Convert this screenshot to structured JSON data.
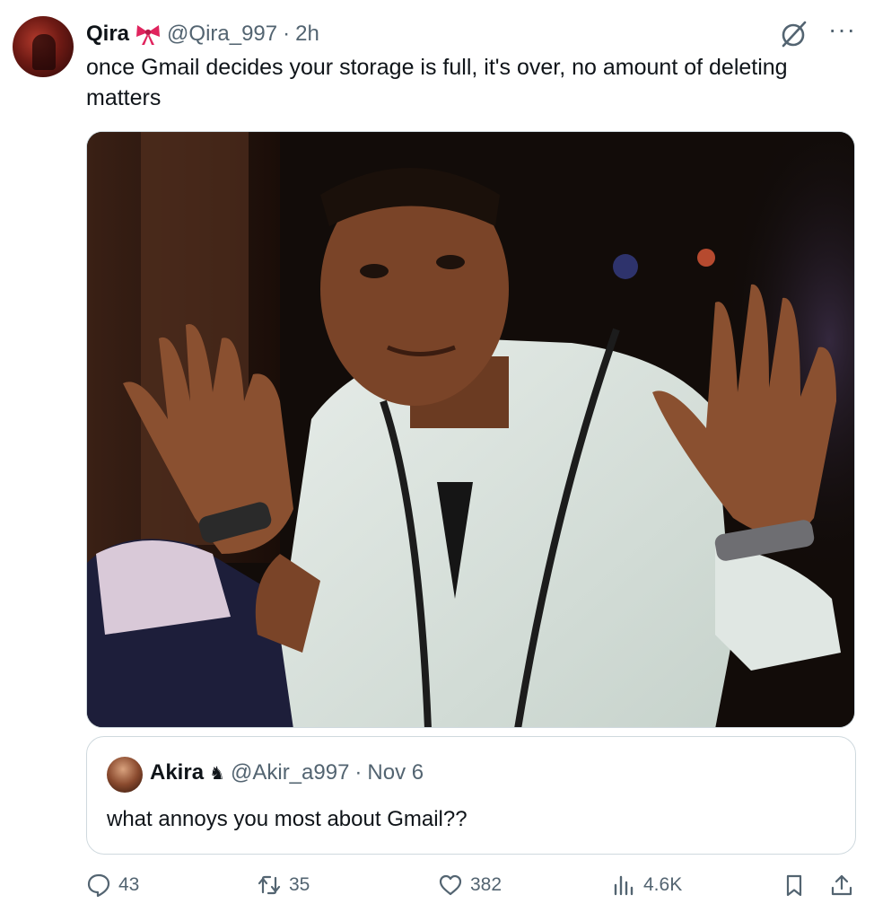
{
  "tweet": {
    "author_name": "Qira",
    "author_handle": "@Qira_997",
    "separator": "·",
    "time": "2h",
    "text": "once Gmail decides your storage is full, it's over, no amount of deleting matters"
  },
  "quoted_tweet": {
    "author_name": "Akira",
    "author_handle": "@Akir_a997",
    "separator": "·",
    "date": "Nov 6",
    "text": "what annoys you most about Gmail??"
  },
  "actions": {
    "replies": "43",
    "retweets": "35",
    "likes": "382",
    "views": "4.6K"
  },
  "icons": {
    "author_badge": "red-bow-icon",
    "quoted_badge": "knight-icon",
    "top_right": [
      "grok-icon",
      "more-icon"
    ],
    "action_bar": [
      "reply-icon",
      "retweet-icon",
      "like-icon",
      "views-icon",
      "bookmark-icon",
      "share-icon"
    ]
  },
  "colors": {
    "text_primary": "#0f1419",
    "text_secondary": "#536471",
    "border": "#cfd9de",
    "bow": "#e0245e"
  }
}
